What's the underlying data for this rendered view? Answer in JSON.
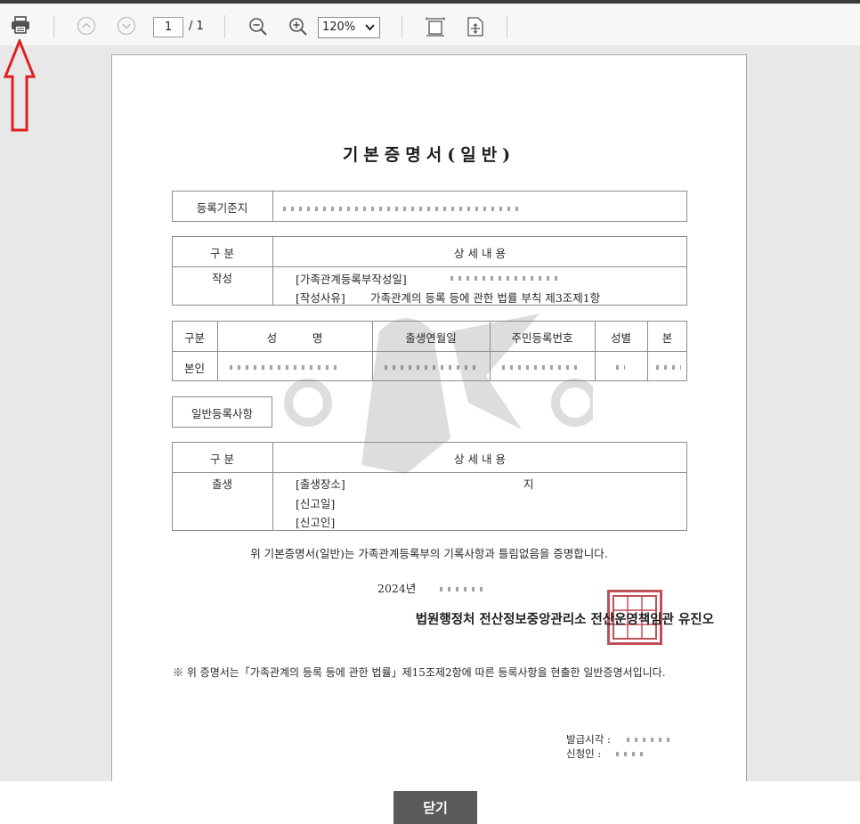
{
  "toolbar": {
    "current_page": "1",
    "total_pages": "/ 1",
    "zoom": "120%",
    "icons": [
      "print-icon",
      "prev-page-icon",
      "next-page-icon",
      "zoom-out-icon",
      "zoom-in-icon",
      "fit-width-icon",
      "fit-page-icon"
    ]
  },
  "document": {
    "title": "기본증명서(일반)",
    "registry_label": "등록기준지",
    "section1": {
      "header_left": "구 분",
      "header_right": "상 세 내 용",
      "row_label": "작성",
      "line1": "[가족관계등록부작성일]",
      "line2_label": "[작성사유]",
      "line2_text": "가족관계의 등록 등에 관한 법률 부칙 제3조제1항"
    },
    "person_table": {
      "headers": [
        "구분",
        "성          명",
        "출생연월일",
        "주민등록번호",
        "성별",
        "본"
      ],
      "row_label": "본인"
    },
    "general_label": "일반등록사항",
    "section2": {
      "header_left": "구 분",
      "header_right": "상 세 내 용",
      "row_label": "출생",
      "lines": [
        "[출생장소]",
        "[신고일]",
        "[신고인]"
      ],
      "place_suffix": "지"
    },
    "certification": "위 기본증명서(일반)는 가족관계등록부의 기록사항과 틀림없음을 증명합니다.",
    "issue_year": "2024년",
    "authority": "법원행정처 전산정보중앙관리소 전산운영책임관 유진오",
    "note": "※ 위 증명서는「가족관계의 등록 등에 관한 법률」제15조제2항에 따른 등록사항을 현출한 일반증명서입니다.",
    "issue_time_label": "발급시각 :",
    "applicant_label": "신청인 :"
  },
  "footer": {
    "close_label": "닫기"
  },
  "colors": {
    "accent_arrow": "#e02020",
    "seal": "#b5323a",
    "close_button": "#5b5b5b"
  }
}
